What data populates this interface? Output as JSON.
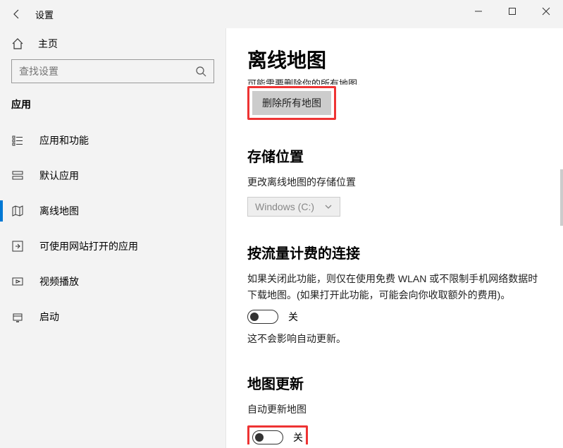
{
  "titlebar": {
    "app_title": "设置"
  },
  "sidebar": {
    "home_label": "主页",
    "search_placeholder": "查找设置",
    "section_label": "应用",
    "items": [
      {
        "label": "应用和功能"
      },
      {
        "label": "默认应用"
      },
      {
        "label": "离线地图"
      },
      {
        "label": "可使用网站打开的应用"
      },
      {
        "label": "视频播放"
      },
      {
        "label": "启动"
      }
    ]
  },
  "main": {
    "page_title": "离线地图",
    "truncated_note": "可能需要删除你的所有地图。",
    "delete_button": "删除所有地图",
    "storage_heading": "存储位置",
    "storage_desc": "更改离线地图的存储位置",
    "storage_select_value": "Windows (C:)",
    "metered_heading": "按流量计费的连接",
    "metered_desc": "如果关闭此功能，则仅在使用免费 WLAN 或不限制手机网络数据时下载地图。(如果打开此功能，可能会向你收取额外的费用)。",
    "metered_toggle_label": "关",
    "metered_note": "这不会影响自动更新。",
    "update_heading": "地图更新",
    "update_desc": "自动更新地图",
    "update_toggle_label": "关"
  }
}
